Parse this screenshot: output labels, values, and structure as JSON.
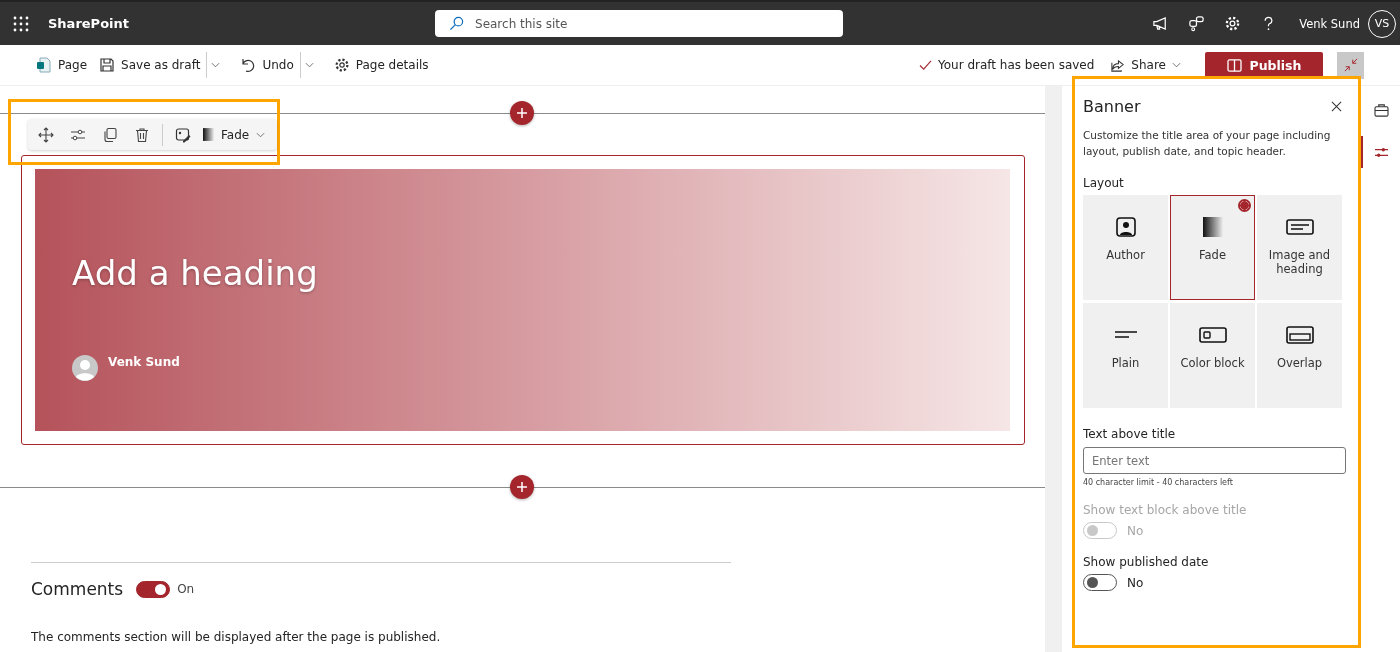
{
  "top_bar": {
    "app_name": "SharePoint",
    "search": {
      "placeholder": "Search this site"
    },
    "user_name": "Venk Sund",
    "avatar_initials": "VS"
  },
  "command_bar": {
    "items": [
      {
        "kind": "page",
        "label": "Page",
        "dropdown": false
      },
      {
        "kind": "save",
        "label": "Save as draft",
        "dropdown": true
      },
      {
        "kind": "undo",
        "label": "Undo",
        "dropdown": true
      },
      {
        "kind": "details",
        "label": "Page details",
        "dropdown": false
      }
    ],
    "status": "Your draft has been saved",
    "share": "Share",
    "publish": "Publish"
  },
  "web_part_toolbar": {
    "layout_label": "Fade"
  },
  "banner": {
    "heading_placeholder": "Add a heading",
    "author": "Venk Sund"
  },
  "comments": {
    "title": "Comments",
    "on": true,
    "state_label": "On",
    "note": "The comments section will be displayed after the page is published."
  },
  "panel": {
    "title": "Banner",
    "description": "Customize the title area of your page including layout, publish date, and topic header.",
    "layout_label": "Layout",
    "layouts": [
      {
        "kind": "author",
        "label": "Author",
        "selected": false
      },
      {
        "kind": "fade",
        "label": "Fade",
        "selected": true
      },
      {
        "kind": "image",
        "label": "Image and heading",
        "selected": false
      },
      {
        "kind": "plain",
        "label": "Plain",
        "selected": false
      },
      {
        "kind": "colorblock",
        "label": "Color block",
        "selected": false
      },
      {
        "kind": "overlap",
        "label": "Overlap",
        "selected": false
      }
    ],
    "text_above_title": {
      "label": "Text above title",
      "placeholder": "Enter text",
      "hint": "40 character limit - 40 characters left"
    },
    "toggles": [
      {
        "label": "Show text block above title",
        "on": false,
        "disabled": true,
        "state_label": "No"
      },
      {
        "label": "Show published date",
        "on": false,
        "disabled": false,
        "state_label": "No"
      }
    ]
  },
  "rail": [
    {
      "kind": "toolbox",
      "selected": false
    },
    {
      "kind": "properties",
      "selected": true
    }
  ]
}
